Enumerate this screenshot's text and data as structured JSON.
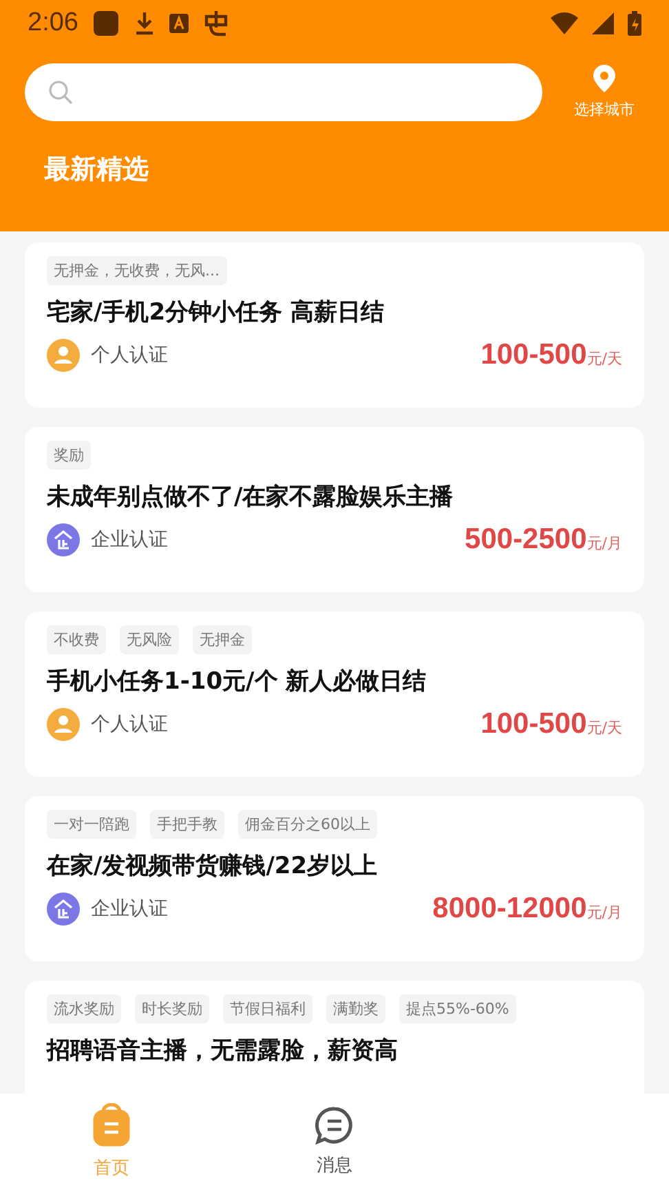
{
  "status_bar": {
    "time": "2:06"
  },
  "city_button": {
    "label": "选择城市"
  },
  "section_title": "最新精选",
  "jobs": [
    {
      "tags": [
        "无押金，无收费，无风..."
      ],
      "title": "宅家/手机2分钟小任务 高薪日结",
      "kind": "personal",
      "cert": "个人认证",
      "salary": "100-500",
      "unit": "元/天"
    },
    {
      "tags": [
        "奖励"
      ],
      "title": "未成年别点做不了/在家不露脸娱乐主播",
      "kind": "company",
      "cert": "企业认证",
      "salary": "500-2500",
      "unit": "元/月"
    },
    {
      "tags": [
        "不收费",
        "无风险",
        "无押金"
      ],
      "title": "手机小任务1-10元/个 新人必做日结",
      "kind": "personal",
      "cert": "个人认证",
      "salary": "100-500",
      "unit": "元/天"
    },
    {
      "tags": [
        "一对一陪跑",
        "手把手教",
        "佣金百分之60以上"
      ],
      "title": "在家/发视频带货赚钱/22岁以上",
      "kind": "company",
      "cert": "企业认证",
      "salary": "8000-12000",
      "unit": "元/月"
    },
    {
      "tags": [
        "流水奖励",
        "时长奖励",
        "节假日福利",
        "满勤奖",
        "提点55%-60%"
      ],
      "title": "招聘语音主播，无需露脸，薪资高"
    }
  ],
  "nav": [
    {
      "label": "首页",
      "selected": true
    },
    {
      "label": "消息",
      "selected": false
    }
  ]
}
